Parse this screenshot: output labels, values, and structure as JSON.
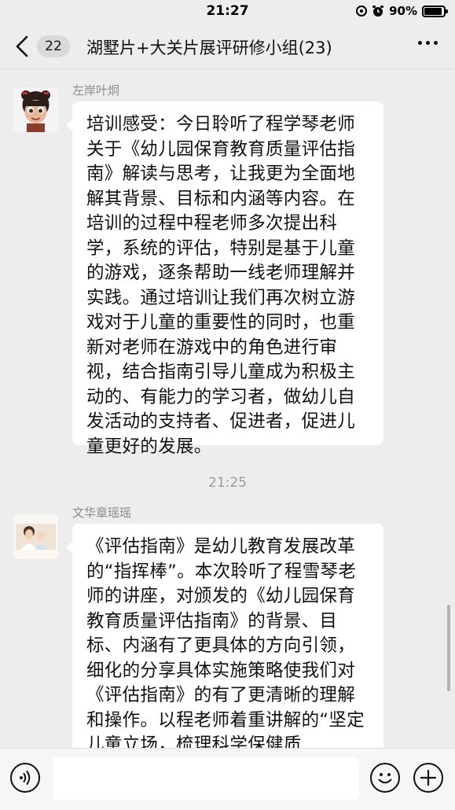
{
  "status_bar": {
    "time": "21:27",
    "battery_text": "90%",
    "battery_level": 0.9,
    "icons": [
      "orientation-lock-icon",
      "alarm-icon",
      "battery-icon"
    ]
  },
  "nav": {
    "back_icon": "chevron-left-icon",
    "unread_count": "22",
    "title": "湖墅片+大关片展评研修小组(23)",
    "more_icon": "more-dots-icon"
  },
  "messages": [
    {
      "sender": "左岸叶炯",
      "avatar": "cartoon-girl-avatar",
      "text": "培训感受：今日聆听了程学琴老师关于《幼儿园保育教育质量评估指南》解读与思考，让我更为全面地解其背景、目标和内涵等内容。在培训的过程中程老师多次提出科学，系统的评估，特别是基于儿童的游戏，逐条帮助一线老师理解并实践。通过培训让我们再次树立游戏对于儿童的重要性的同时，也重新对老师在游戏中的角色进行审视，结合指南引导儿童成为积极主动的、有能力的学习者，做幼儿自发活动的支持者、促进者，促进儿童更好的发展。"
    },
    {
      "time_divider": "21:25",
      "sender": "文华章瑶瑶",
      "avatar": "mother-child-photo-avatar",
      "text": "《评估指南》是幼儿教育发展改革的“指挥棒”。本次聆听了程雪琴老师的讲座，对颁发的《幼儿园保育教育质量评估指南》的背景、目标、内涵有了更具体的方向引领，细化的分享具体实施策略使我们对《评估指南》的有了更清晰的理解和操作。以程老师着重讲解的“坚定儿童立场，梳理科学保健质"
    }
  ],
  "input_bar": {
    "voice_icon": "voice-icon",
    "input_value": "",
    "emoji_icon": "emoji-icon",
    "plus_icon": "plus-icon"
  }
}
